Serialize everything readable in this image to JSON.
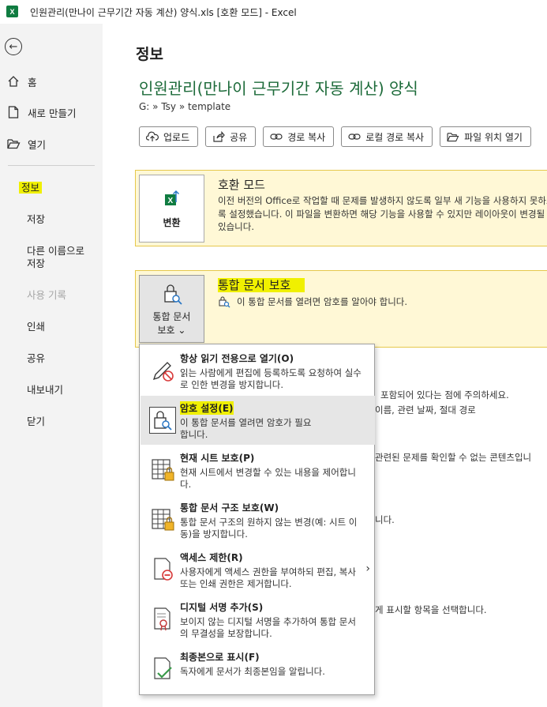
{
  "titlebar": {
    "logo": "X",
    "title": "인원관리(만나이 근무기간 자동 계산) 양식.xls  [호환 모드]  -  Excel"
  },
  "sidebar": {
    "top_items": [
      {
        "label": "홈",
        "icon": "home-icon"
      },
      {
        "label": "새로 만들기",
        "icon": "new-document-icon"
      },
      {
        "label": "열기",
        "icon": "folder-open-icon"
      }
    ],
    "items": [
      {
        "label": "정보"
      },
      {
        "label": "저장"
      },
      {
        "label": "다른 이름으로 저장"
      },
      {
        "label": "사용 기록"
      },
      {
        "label": "인쇄"
      },
      {
        "label": "공유"
      },
      {
        "label": "내보내기"
      },
      {
        "label": "닫기"
      }
    ]
  },
  "main": {
    "page_title": "정보",
    "doc_title": "인원관리(만나이 근무기간 자동 계산) 양식",
    "path": "G: » Tsy » template",
    "actions": [
      {
        "label": "업로드",
        "icon": "upload-icon"
      },
      {
        "label": "공유",
        "icon": "share-icon"
      },
      {
        "label": "경로 복사",
        "icon": "link-icon"
      },
      {
        "label": "로컬 경로 복사",
        "icon": "link-icon"
      },
      {
        "label": "파일 위치 열기",
        "icon": "folder-open-icon"
      }
    ],
    "compat": {
      "button_label": "변환",
      "heading": "호환 모드",
      "body": "이전 버전의 Office로 작업할 때 문제를 발생하지 않도록 일부 새 기능을 사용하지 못하도록 설정했습니다. 이 파일을 변환하면 해당 기능을 사용할 수 있지만 레이아웃이 변경될 수 있습니다."
    },
    "protect": {
      "button_label_1": "통합 문서",
      "button_label_2": "보호",
      "button_caret": "⌄",
      "heading": "통합 문서 보호",
      "body": "이 통합 문서를 열려면 암호를 알아야 합니다."
    },
    "bg_texts": [
      "포함되어 있다는 점에 주의하세요.",
      "이름, 관련 날짜, 절대 경로",
      "관련된 문제를 확인할 수 없는 콘텐츠입니",
      "니다.",
      "게 표시할 항목을 선택합니다."
    ]
  },
  "menu": {
    "items": [
      {
        "title": "항상 읽기 전용으로 열기(O)",
        "desc": "읽는 사람에게 편집에 등록하도록 요청하여 실수로 인한 변경을 방지합니다.",
        "icon": "pencil-no-icon"
      },
      {
        "title": "암호 설정(E)",
        "desc": "이 통합 문서를 열려면 암호가 필요합니다.",
        "icon": "lock-search-icon"
      },
      {
        "title": "현재 시트 보호(P)",
        "desc": "현재 시트에서 변경할 수 있는 내용을 제어합니다.",
        "icon": "sheet-lock-icon"
      },
      {
        "title": "통합 문서 구조 보호(W)",
        "desc": "통합 문서 구조의 원하지 않는 변경(예: 시트 이동)을 방지합니다.",
        "icon": "workbook-lock-icon"
      },
      {
        "title": "액세스 제한(R)",
        "desc": "사용자에게 액세스 권한을 부여하되 편집, 복사 또는 인쇄 권한은 제거합니다.",
        "icon": "restrict-access-icon",
        "arrow": "›"
      },
      {
        "title": "디지털 서명 추가(S)",
        "desc": "보이지 않는 디지털 서명을 추가하여 통합 문서의 무결성을 보장합니다.",
        "icon": "digital-signature-icon"
      },
      {
        "title": "최종본으로 표시(F)",
        "desc": "독자에게 문서가 최종본임을 알립니다.",
        "icon": "mark-final-icon"
      }
    ]
  }
}
